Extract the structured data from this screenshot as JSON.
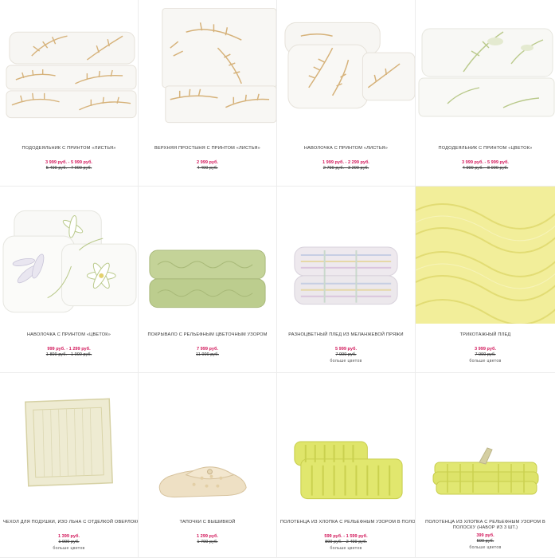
{
  "products": [
    {
      "name": "пододеяльник с принтом «листья»",
      "price": "3 999 руб. - 5 999 руб.",
      "old_price": "5 499 руб. - 7 999 руб.",
      "more_colors": ""
    },
    {
      "name": "верхняя простыня с принтом «листья»",
      "price": "2 999 руб.",
      "old_price": "4 499 руб.",
      "more_colors": ""
    },
    {
      "name": "наволочка с принтом «листья»",
      "price": "1 999 руб. - 2 299 руб.",
      "old_price": "2 799 руб. - 3 299 руб.",
      "more_colors": ""
    },
    {
      "name": "пододеяльник с принтом «цветок»",
      "price": "3 999 руб. - 5 999 руб.",
      "old_price": "4 999 руб. - 8 999 руб.",
      "more_colors": ""
    },
    {
      "name": "наволочка с принтом «цветок»",
      "price": "999 руб. - 1 299 руб.",
      "old_price": "1 899 руб. - 1 999 руб.",
      "more_colors": ""
    },
    {
      "name": "покрывало с рельефным цветочным узором",
      "price": "7 999 руб.",
      "old_price": "11 999 руб.",
      "more_colors": ""
    },
    {
      "name": "разноцветный плед из меланжевой пряжи",
      "price": "5 999 руб.",
      "old_price": "7 999 руб.",
      "more_colors": "больше цветов"
    },
    {
      "name": "трикотажный плед",
      "price": "3 999 руб.",
      "old_price": "7 999 руб.",
      "more_colors": "больше цветов"
    },
    {
      "name": "чехол для подушки, изо льна с отделкой оверлоком",
      "price": "1 399 руб.",
      "old_price": "1 999 руб.",
      "more_colors": "больше цветов"
    },
    {
      "name": "тапочки с вышивкой",
      "price": "1 299 руб.",
      "old_price": "1 799 руб.",
      "more_colors": ""
    },
    {
      "name": "полотенца из хлопка с рельефным узором в полоску",
      "price": "599 руб. - 1 599 руб.",
      "old_price": "899 руб. - 2 499 руб.",
      "more_colors": "больше цветов"
    },
    {
      "name": "полотенца из хлопка с рельефным узором в полоску (набор из 3 шт.)",
      "price": "399 руб.",
      "old_price": "599 руб.",
      "more_colors": "больше цветов"
    }
  ],
  "colors": {
    "sale_price": "#d2185b",
    "leaf_gold": "#d6b27a",
    "lime": "#d9e25a",
    "sage": "#b9c98a",
    "yellow_knit": "#f2ee9a"
  }
}
